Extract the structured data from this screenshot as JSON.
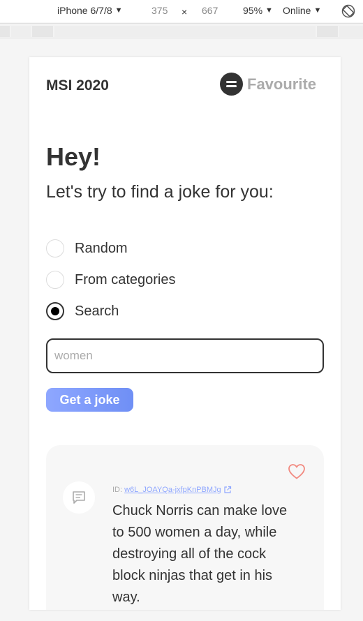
{
  "devtools": {
    "device": "iPhone 6/7/8",
    "width": "375",
    "times": "×",
    "height": "667",
    "zoom": "95%",
    "network": "Online",
    "caret": "▼"
  },
  "header": {
    "brand": "MSI 2020",
    "favourite_label": "Favourite"
  },
  "greeting": {
    "title": "Hey!",
    "subtitle": "Let's try to find a joke for you:"
  },
  "options": [
    {
      "label": "Random",
      "checked": false
    },
    {
      "label": "From categories",
      "checked": false
    },
    {
      "label": "Search",
      "checked": true
    }
  ],
  "search": {
    "value": "",
    "placeholder": "women"
  },
  "action": {
    "button_label": "Get a joke"
  },
  "joke": {
    "id_prefix": "ID:",
    "id": "w6L_JOAYQa-jxfpKnPBMJg",
    "text": "Chuck Norris can make love to 500 women a day, while destroying all of the cock block ninjas that get in his way."
  },
  "colors": {
    "accent": "#8fa7ff",
    "text": "#333333",
    "muted": "#ababab",
    "heart": "#f28b82",
    "card_bg": "#f7f7f7"
  },
  "icons": [
    "rotate-icon",
    "menu-icon",
    "heart-icon",
    "message-icon",
    "external-link-icon"
  ]
}
